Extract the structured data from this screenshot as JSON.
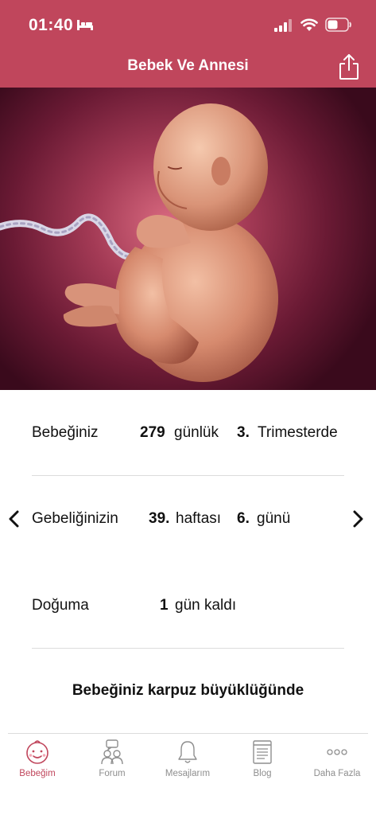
{
  "status": {
    "time": "01:40"
  },
  "nav": {
    "title": "Bebek Ve Annesi"
  },
  "hero": {
    "image_alt_icon": "fetus-illustration"
  },
  "row1": {
    "label": "Bebeğiniz",
    "days_value": "279",
    "days_unit": "günlük",
    "trimester_value": "3.",
    "trimester_unit": "Trimesterde"
  },
  "row2": {
    "label": "Gebeliğinizin",
    "week_value": "39.",
    "week_unit": "haftası",
    "day_value": "6.",
    "day_unit": "günü"
  },
  "row3": {
    "label": "Doğuma",
    "remaining_value": "1",
    "remaining_unit": "gün kaldı"
  },
  "size_text": "Bebeğiniz karpuz büyüklüğünde",
  "tabs": [
    {
      "label": "Bebeğim",
      "icon": "baby-face-icon",
      "active": true
    },
    {
      "label": "Forum",
      "icon": "forum-people-icon",
      "active": false
    },
    {
      "label": "Mesajlarım",
      "icon": "bell-icon",
      "active": false
    },
    {
      "label": "Blog",
      "icon": "notepad-icon",
      "active": false
    },
    {
      "label": "Daha Fazla",
      "icon": "more-dots-icon",
      "active": false
    }
  ],
  "colors": {
    "accent": "#c0465c",
    "inactive_tab": "#8e8e8e"
  }
}
